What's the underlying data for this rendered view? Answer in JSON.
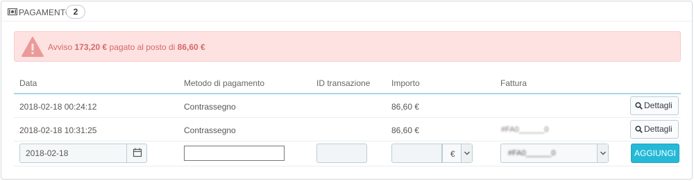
{
  "panel": {
    "title": "PAGAMENTO",
    "count": "2",
    "icon": "money-icon"
  },
  "alert": {
    "prefix": "Avviso",
    "paid_amount": "173,20 €",
    "middle": "pagato al posto di",
    "expected_amount": "86,60 €",
    "color": "#d26a69",
    "background": "#fde2e1"
  },
  "table": {
    "headers": [
      "Data",
      "Metodo di pagamento",
      "ID transazione",
      "Importo",
      "Fattura"
    ],
    "rows": [
      {
        "date": "2018-02-18 00:24:12",
        "method": "Contrassegno",
        "transaction_id": "",
        "amount": "86,60 €",
        "invoice": "",
        "details_label": "Dettagli"
      },
      {
        "date": "2018-02-18 10:31:25",
        "method": "Contrassegno",
        "transaction_id": "",
        "amount": "86,60 €",
        "invoice": "#FA0______0",
        "details_label": "Dettagli"
      }
    ]
  },
  "form": {
    "date_value": "2018-02-18",
    "method_value": "",
    "transaction_id_value": "",
    "amount_value": "",
    "currency_value": "€",
    "invoice_value": "#FA0______0",
    "add_label": "AGGIUNGI",
    "accent": "#25b9d7"
  }
}
